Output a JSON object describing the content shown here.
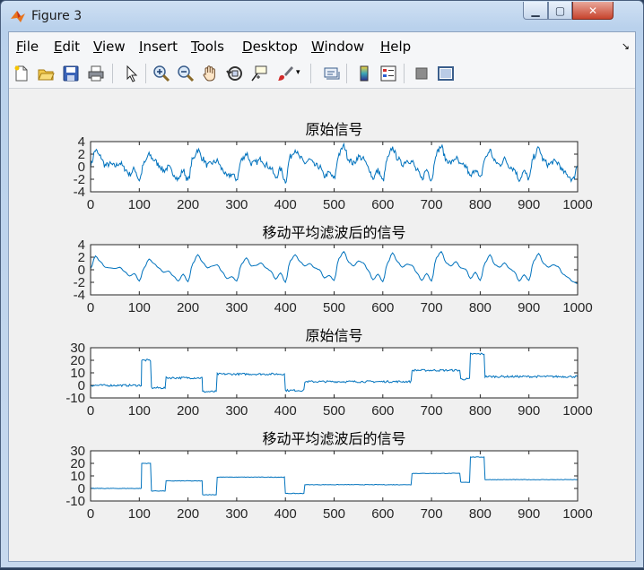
{
  "window": {
    "title": "Figure 3"
  },
  "menu": [
    "File",
    "Edit",
    "View",
    "Insert",
    "Tools",
    "Desktop",
    "Window",
    "Help"
  ],
  "toolbar": [
    "new-figure",
    "open-file",
    "save",
    "print",
    "select-arrow",
    "zoom-in",
    "zoom-out",
    "pan",
    "rotate-3d",
    "data-cursor",
    "brush",
    "link-plot",
    "colorbar",
    "legend",
    "hide-plot-tools",
    "show-plot-tools"
  ],
  "colors": {
    "line": "#0072bd",
    "axes_bg": "#ffffff",
    "figure_bg": "#f0f0f0"
  },
  "chart_data": [
    {
      "type": "line",
      "title": "原始信号",
      "xlim": [
        0,
        1000
      ],
      "ylim": [
        -4,
        4
      ],
      "xticks": [
        0,
        100,
        200,
        300,
        400,
        500,
        600,
        700,
        800,
        900,
        1000
      ],
      "yticks": [
        4,
        2,
        0,
        -2,
        -4
      ],
      "series": [
        {
          "points": [
            [
              0,
              0.3
            ],
            [
              10,
              2.6
            ],
            [
              20,
              1.6
            ],
            [
              30,
              0.2
            ],
            [
              40,
              0.4
            ],
            [
              50,
              0.1
            ],
            [
              60,
              0.6
            ],
            [
              70,
              -0.3
            ],
            [
              80,
              -1.2
            ],
            [
              90,
              -0.4
            ],
            [
              100,
              -2.1
            ],
            [
              110,
              0.5
            ],
            [
              120,
              1.9
            ],
            [
              130,
              1.1
            ],
            [
              140,
              0.3
            ],
            [
              150,
              -0.6
            ],
            [
              160,
              -0.1
            ],
            [
              170,
              -1.1
            ],
            [
              180,
              -2.0
            ],
            [
              190,
              -0.6
            ],
            [
              200,
              -2.2
            ],
            [
              210,
              1.2
            ],
            [
              220,
              2.7
            ],
            [
              230,
              1.3
            ],
            [
              240,
              0.2
            ],
            [
              250,
              0.6
            ],
            [
              260,
              0.9
            ],
            [
              270,
              -0.4
            ],
            [
              280,
              -1.6
            ],
            [
              290,
              -1.2
            ],
            [
              300,
              -2.0
            ],
            [
              310,
              1.1
            ],
            [
              320,
              2.1
            ],
            [
              330,
              0.5
            ],
            [
              340,
              0.7
            ],
            [
              350,
              1.2
            ],
            [
              360,
              0.3
            ],
            [
              370,
              -0.2
            ],
            [
              380,
              -1.7
            ],
            [
              390,
              -0.4
            ],
            [
              400,
              -2.3
            ],
            [
              410,
              1.6
            ],
            [
              420,
              2.7
            ],
            [
              430,
              1.4
            ],
            [
              440,
              0.6
            ],
            [
              450,
              1.1
            ],
            [
              460,
              0.2
            ],
            [
              470,
              0.0
            ],
            [
              480,
              -1.5
            ],
            [
              490,
              -1.0
            ],
            [
              500,
              -1.9
            ],
            [
              510,
              2.0
            ],
            [
              520,
              3.3
            ],
            [
              530,
              1.2
            ],
            [
              540,
              0.5
            ],
            [
              550,
              1.6
            ],
            [
              560,
              1.2
            ],
            [
              570,
              -0.1
            ],
            [
              580,
              -1.8
            ],
            [
              590,
              -0.6
            ],
            [
              600,
              -2.2
            ],
            [
              610,
              1.3
            ],
            [
              620,
              3.0
            ],
            [
              630,
              1.4
            ],
            [
              640,
              0.4
            ],
            [
              650,
              1.0
            ],
            [
              660,
              0.8
            ],
            [
              670,
              -0.6
            ],
            [
              680,
              -1.9
            ],
            [
              690,
              -0.5
            ],
            [
              700,
              -2.0
            ],
            [
              710,
              2.2
            ],
            [
              720,
              3.2
            ],
            [
              730,
              1.1
            ],
            [
              740,
              0.6
            ],
            [
              750,
              1.4
            ],
            [
              760,
              0.2
            ],
            [
              770,
              0.1
            ],
            [
              780,
              -1.6
            ],
            [
              790,
              -0.3
            ],
            [
              800,
              -1.9
            ],
            [
              810,
              1.3
            ],
            [
              820,
              2.6
            ],
            [
              830,
              0.8
            ],
            [
              840,
              0.3
            ],
            [
              850,
              1.2
            ],
            [
              860,
              0.1
            ],
            [
              870,
              -0.4
            ],
            [
              880,
              -2.0
            ],
            [
              890,
              -0.8
            ],
            [
              900,
              -1.9
            ],
            [
              910,
              1.6
            ],
            [
              920,
              2.9
            ],
            [
              930,
              1.0
            ],
            [
              940,
              0.3
            ],
            [
              950,
              0.8
            ],
            [
              960,
              0.6
            ],
            [
              970,
              -0.8
            ],
            [
              980,
              -1.4
            ],
            [
              990,
              -2.1
            ],
            [
              1000,
              0.2
            ]
          ]
        }
      ]
    },
    {
      "type": "line",
      "title": "移动平均滤波后的信号",
      "xlim": [
        0,
        1000
      ],
      "ylim": [
        -4,
        4
      ],
      "xticks": [
        0,
        100,
        200,
        300,
        400,
        500,
        600,
        700,
        800,
        900,
        1000
      ],
      "yticks": [
        4,
        2,
        0,
        -2,
        -4
      ],
      "series": [
        {
          "points": [
            [
              0,
              0.2
            ],
            [
              10,
              2.2
            ],
            [
              20,
              1.3
            ],
            [
              30,
              0.4
            ],
            [
              40,
              0.3
            ],
            [
              50,
              0.2
            ],
            [
              60,
              0.4
            ],
            [
              70,
              -0.3
            ],
            [
              80,
              -1.0
            ],
            [
              90,
              -0.6
            ],
            [
              100,
              -1.8
            ],
            [
              110,
              0.3
            ],
            [
              120,
              1.7
            ],
            [
              130,
              1.0
            ],
            [
              140,
              0.3
            ],
            [
              150,
              -0.4
            ],
            [
              160,
              -0.2
            ],
            [
              170,
              -1.0
            ],
            [
              180,
              -1.8
            ],
            [
              190,
              -0.7
            ],
            [
              200,
              -1.9
            ],
            [
              210,
              1.0
            ],
            [
              220,
              2.4
            ],
            [
              230,
              1.2
            ],
            [
              240,
              0.3
            ],
            [
              250,
              0.6
            ],
            [
              260,
              0.8
            ],
            [
              270,
              -0.3
            ],
            [
              280,
              -1.4
            ],
            [
              290,
              -1.1
            ],
            [
              300,
              -1.8
            ],
            [
              310,
              0.9
            ],
            [
              320,
              1.9
            ],
            [
              330,
              0.6
            ],
            [
              340,
              0.7
            ],
            [
              350,
              1.1
            ],
            [
              360,
              0.3
            ],
            [
              370,
              -0.2
            ],
            [
              380,
              -1.5
            ],
            [
              390,
              -0.5
            ],
            [
              400,
              -2.0
            ],
            [
              410,
              1.4
            ],
            [
              420,
              2.4
            ],
            [
              430,
              1.3
            ],
            [
              440,
              0.6
            ],
            [
              450,
              1.0
            ],
            [
              460,
              0.3
            ],
            [
              470,
              0.0
            ],
            [
              480,
              -1.3
            ],
            [
              490,
              -0.9
            ],
            [
              500,
              -1.7
            ],
            [
              510,
              1.8
            ],
            [
              520,
              2.9
            ],
            [
              530,
              1.2
            ],
            [
              540,
              0.6
            ],
            [
              550,
              1.4
            ],
            [
              560,
              1.1
            ],
            [
              570,
              -0.1
            ],
            [
              580,
              -1.6
            ],
            [
              590,
              -0.7
            ],
            [
              600,
              -1.9
            ],
            [
              610,
              1.1
            ],
            [
              620,
              2.7
            ],
            [
              630,
              1.3
            ],
            [
              640,
              0.4
            ],
            [
              650,
              0.9
            ],
            [
              660,
              0.7
            ],
            [
              670,
              -0.5
            ],
            [
              680,
              -1.7
            ],
            [
              690,
              -0.6
            ],
            [
              700,
              -1.8
            ],
            [
              710,
              1.9
            ],
            [
              720,
              2.9
            ],
            [
              730,
              1.1
            ],
            [
              740,
              0.6
            ],
            [
              750,
              1.3
            ],
            [
              760,
              0.3
            ],
            [
              770,
              0.1
            ],
            [
              780,
              -1.4
            ],
            [
              790,
              -0.4
            ],
            [
              800,
              -1.7
            ],
            [
              810,
              1.1
            ],
            [
              820,
              2.4
            ],
            [
              830,
              0.8
            ],
            [
              840,
              0.4
            ],
            [
              850,
              1.1
            ],
            [
              860,
              0.2
            ],
            [
              870,
              -0.3
            ],
            [
              880,
              -1.8
            ],
            [
              890,
              -0.8
            ],
            [
              900,
              -1.7
            ],
            [
              910,
              1.4
            ],
            [
              920,
              2.6
            ],
            [
              930,
              1.0
            ],
            [
              940,
              0.4
            ],
            [
              950,
              0.8
            ],
            [
              960,
              0.5
            ],
            [
              970,
              -0.7
            ],
            [
              980,
              -1.2
            ],
            [
              990,
              -1.9
            ],
            [
              1000,
              -2.2
            ]
          ]
        }
      ]
    },
    {
      "type": "line",
      "title": "原始信号",
      "xlim": [
        0,
        1000
      ],
      "ylim": [
        -10,
        30
      ],
      "xticks": [
        0,
        100,
        200,
        300,
        400,
        500,
        600,
        700,
        800,
        900,
        1000
      ],
      "yticks": [
        30,
        20,
        10,
        0,
        -10
      ],
      "series": [
        {
          "steps": [
            [
              0,
              0
            ],
            [
              105,
              20
            ],
            [
              125,
              -2
            ],
            [
              155,
              6
            ],
            [
              230,
              -5
            ],
            [
              260,
              9
            ],
            [
              400,
              -4
            ],
            [
              440,
              3
            ],
            [
              660,
              12
            ],
            [
              760,
              5
            ],
            [
              780,
              25
            ],
            [
              810,
              7
            ],
            [
              1000,
              7
            ]
          ]
        }
      ]
    },
    {
      "type": "line",
      "title": "移动平均滤波后的信号",
      "xlim": [
        0,
        1000
      ],
      "ylim": [
        -10,
        30
      ],
      "xticks": [
        0,
        100,
        200,
        300,
        400,
        500,
        600,
        700,
        800,
        900,
        1000
      ],
      "yticks": [
        30,
        20,
        10,
        0,
        -10
      ],
      "series": [
        {
          "steps": [
            [
              0,
              0
            ],
            [
              105,
              20
            ],
            [
              125,
              -2
            ],
            [
              155,
              6
            ],
            [
              230,
              -5
            ],
            [
              260,
              9
            ],
            [
              400,
              -4
            ],
            [
              440,
              3
            ],
            [
              660,
              12
            ],
            [
              760,
              5
            ],
            [
              780,
              25
            ],
            [
              810,
              7
            ],
            [
              1000,
              7
            ]
          ]
        }
      ]
    }
  ]
}
